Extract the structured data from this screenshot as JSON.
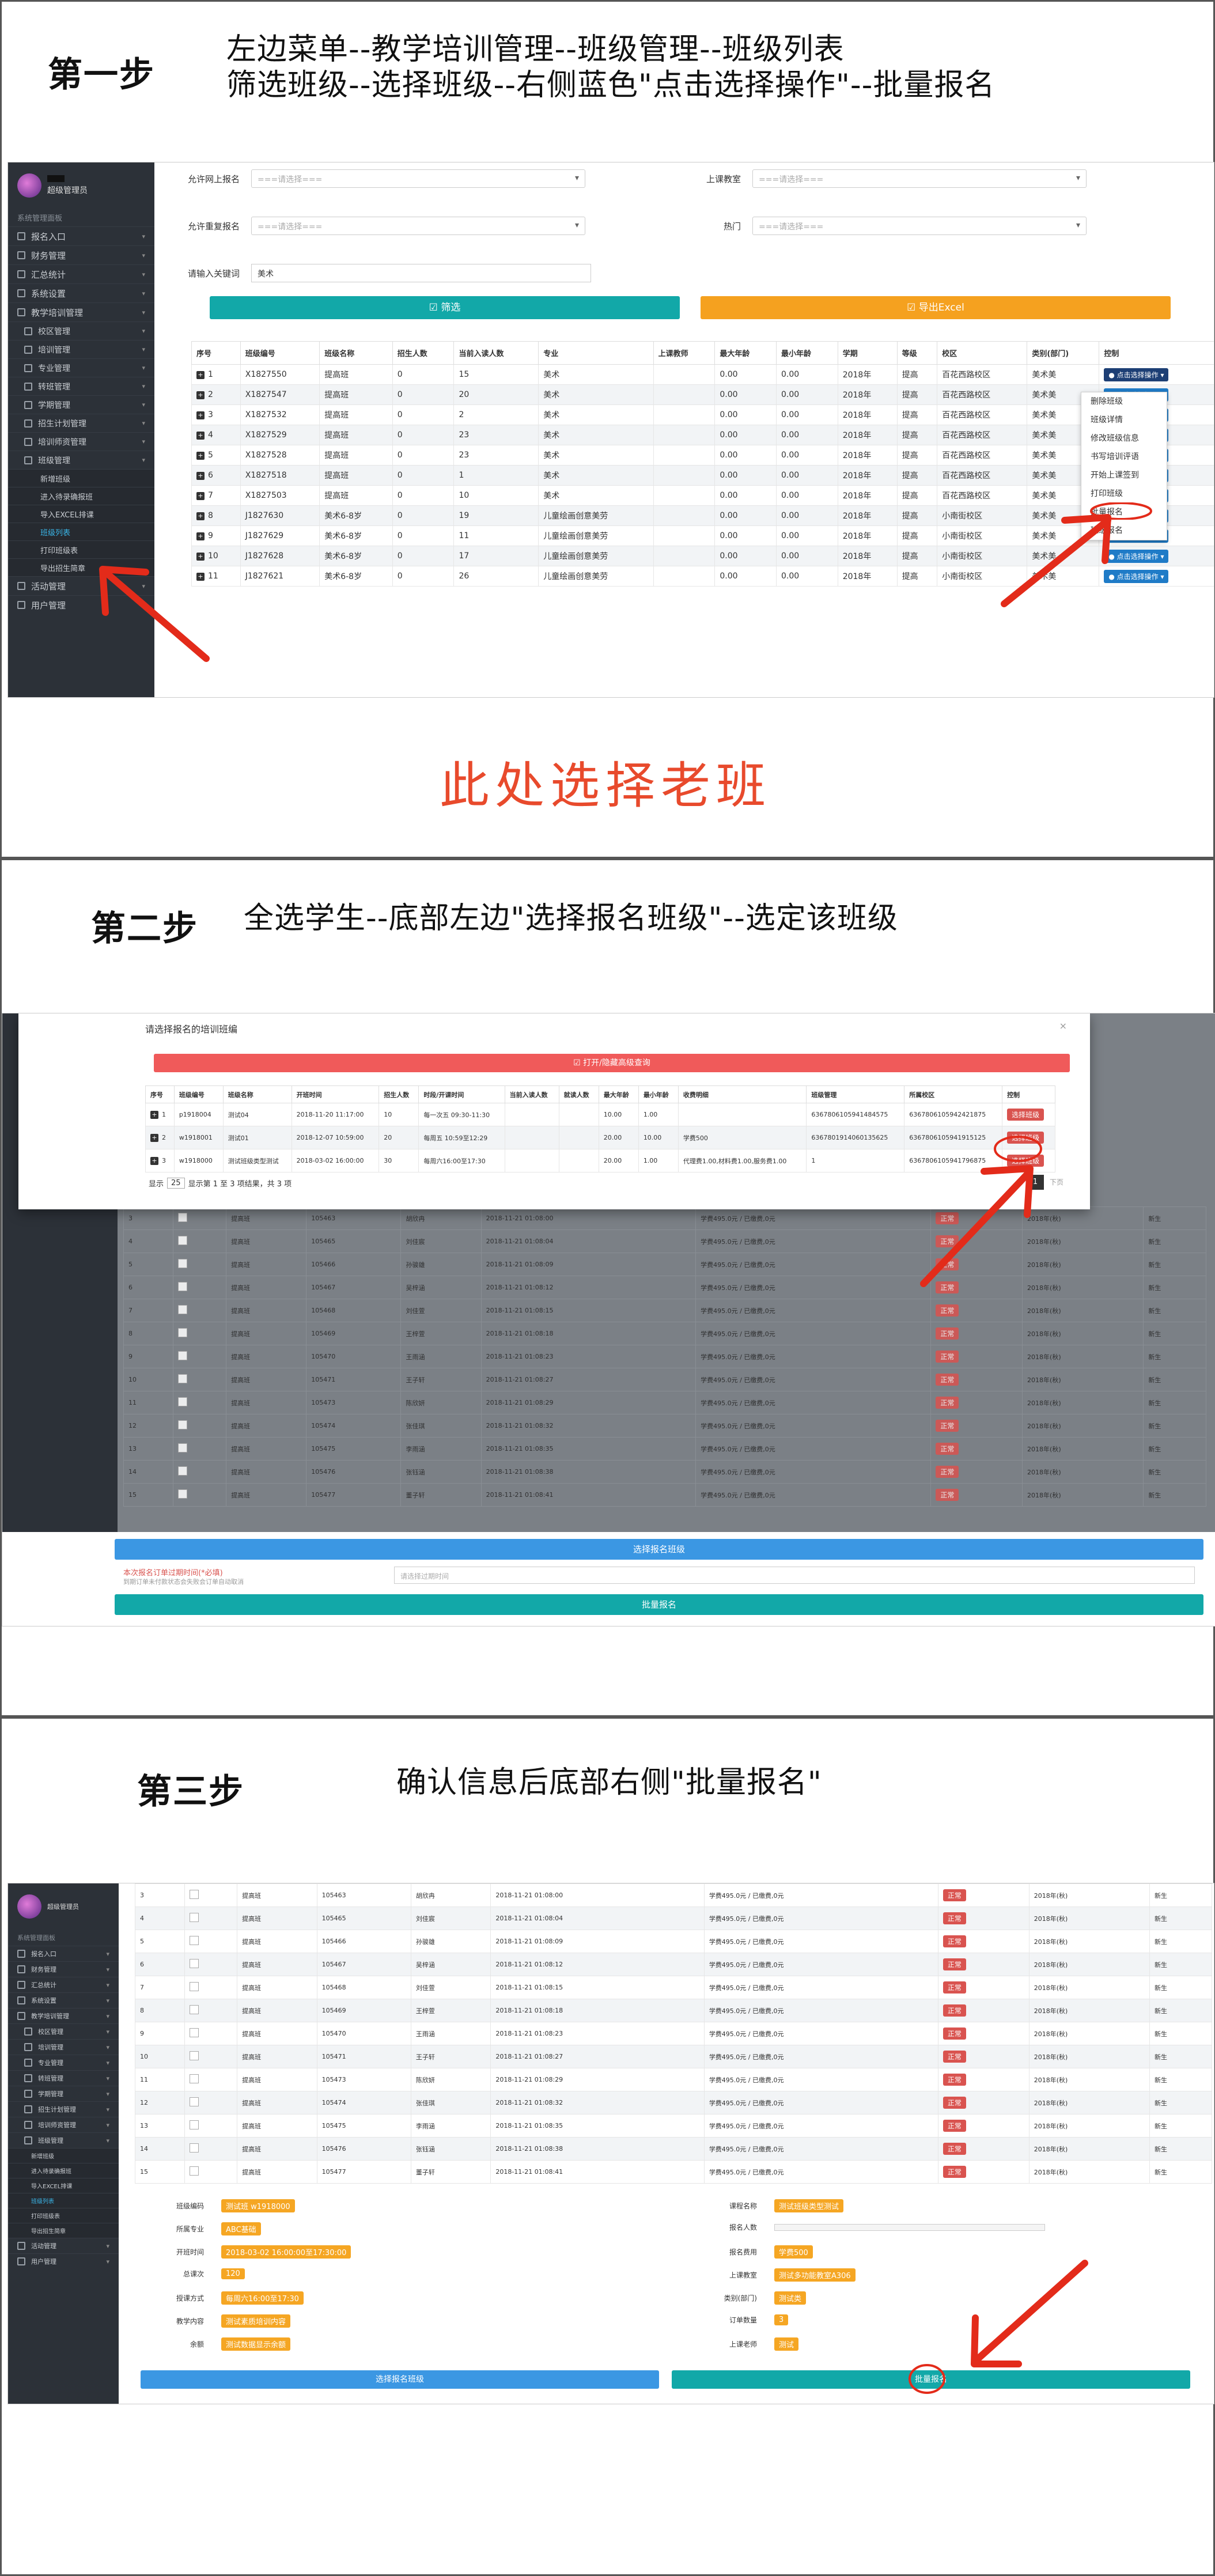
{
  "step1": {
    "label": "第一步",
    "desc1": "左边菜单--教学培训管理--班级管理--班级列表",
    "desc2": "筛选班级--选择班级--右侧蓝色\"点击选择操作\"--批量报名",
    "note": "此处选择老班",
    "sidebar": {
      "user": "超级管理员",
      "section": "系统管理面板",
      "items": [
        "报名入口",
        "财务管理",
        "汇总统计",
        "系统设置",
        "教学培训管理"
      ],
      "subitems": [
        "校区管理",
        "培训管理",
        "专业管理",
        "转班管理",
        "学期管理",
        "招生计划管理",
        "培训师资管理",
        "班级管理"
      ],
      "sub2": [
        "新增班级",
        "进入待录确报班",
        "导入EXCEL排课",
        "班级列表",
        "打印班级表",
        "导出招生简章"
      ],
      "bottom": [
        "活动管理",
        "用户管理"
      ]
    },
    "filters": {
      "f1_label": "允许网上报名",
      "f1_val": "===请选择===",
      "f2_label": "上课教室",
      "f2_val": "===请选择===",
      "f3_label": "允许重复报名",
      "f3_val": "===请选择===",
      "f4_label": "热门",
      "f4_val": "===请选择===",
      "kw_label": "请输入关键词",
      "kw_val": "美术"
    },
    "btn_filter": "☑ 筛选",
    "btn_export": "☑ 导出Excel",
    "columns": [
      "序号",
      "班级编号",
      "班级名称",
      "招生人数",
      "当前入读人数",
      "专业",
      "上课教师",
      "最大年龄",
      "最小年龄",
      "学期",
      "等级",
      "校区",
      "类别(部门)",
      "控制"
    ],
    "rows": [
      [
        "1",
        "X1827550",
        "提高班",
        "0",
        "15",
        "美术",
        "",
        "0.00",
        "0.00",
        "2018年",
        "提高",
        "百花西路校区",
        "美术美"
      ],
      [
        "2",
        "X1827547",
        "提高班",
        "0",
        "20",
        "美术",
        "",
        "0.00",
        "0.00",
        "2018年",
        "提高",
        "百花西路校区",
        "美术美"
      ],
      [
        "3",
        "X1827532",
        "提高班",
        "0",
        "2",
        "美术",
        "",
        "0.00",
        "0.00",
        "2018年",
        "提高",
        "百花西路校区",
        "美术美"
      ],
      [
        "4",
        "X1827529",
        "提高班",
        "0",
        "23",
        "美术",
        "",
        "0.00",
        "0.00",
        "2018年",
        "提高",
        "百花西路校区",
        "美术美"
      ],
      [
        "5",
        "X1827528",
        "提高班",
        "0",
        "23",
        "美术",
        "",
        "0.00",
        "0.00",
        "2018年",
        "提高",
        "百花西路校区",
        "美术美"
      ],
      [
        "6",
        "X1827518",
        "提高班",
        "0",
        "1",
        "美术",
        "",
        "0.00",
        "0.00",
        "2018年",
        "提高",
        "百花西路校区",
        "美术美"
      ],
      [
        "7",
        "X1827503",
        "提高班",
        "0",
        "10",
        "美术",
        "",
        "0.00",
        "0.00",
        "2018年",
        "提高",
        "百花西路校区",
        "美术美"
      ],
      [
        "8",
        "J1827630",
        "美术6-8岁",
        "0",
        "19",
        "儿童绘画创意美劳",
        "",
        "0.00",
        "0.00",
        "2018年",
        "提高",
        "小南街校区",
        "美术美"
      ],
      [
        "9",
        "J1827629",
        "美术6-8岁",
        "0",
        "11",
        "儿童绘画创意美劳",
        "",
        "0.00",
        "0.00",
        "2018年",
        "提高",
        "小南街校区",
        "美术美"
      ],
      [
        "10",
        "J1827628",
        "美术6-8岁",
        "0",
        "17",
        "儿童绘画创意美劳",
        "",
        "0.00",
        "0.00",
        "2018年",
        "提高",
        "小南街校区",
        "美术美"
      ],
      [
        "11",
        "J1827621",
        "美术6-8岁",
        "0",
        "26",
        "儿童绘画创意美劳",
        "",
        "0.00",
        "0.00",
        "2018年",
        "提高",
        "小南街校区",
        "美术美"
      ]
    ],
    "op_label": "● 点击选择操作 ▾",
    "menu": [
      "删除班级",
      "班级详情",
      "修改班级信息",
      "书写培训评语",
      "开始上课签到",
      "打印班级",
      "批量报名",
      "班级报名"
    ]
  },
  "step2": {
    "label": "第二步",
    "desc": "全选学生--底部左边\"选择报名班级\"--选定该班级",
    "modal_title": "请选择报名的培训班编",
    "modal_btn": "☑ 打开/隐藏高级查询",
    "columns": [
      "序号",
      "班级编号",
      "班级名称",
      "开班时间",
      "招生人数",
      "时段/开课时间",
      "当前入读人数",
      "就读人数",
      "最大年龄",
      "最小年龄",
      "收费明细",
      "班级管理",
      "所属校区",
      "控制"
    ],
    "rows": [
      [
        "1",
        "p1918004",
        "测试04",
        "2018-11-20 11:17:00",
        "10",
        "每一次五 09:30-11:30",
        "",
        "",
        "10.00",
        "1.00",
        "",
        "6367806105941484575",
        "6367806105942421875"
      ],
      [
        "2",
        "w1918001",
        "测试01",
        "2018-12-07 10:59:00",
        "20",
        "每周五 10:59至12:29",
        "",
        "",
        "20.00",
        "10.00",
        "学费500",
        "6367801914060135625",
        "6367806105941915125"
      ],
      [
        "3",
        "w1918000",
        "测试班级类型测试",
        "2018-03-02 16:00:00",
        "30",
        "每周六16:00至17:30",
        "",
        "",
        "20.00",
        "1.00",
        "代理费1.00,材料费1.00,服务费1.00",
        "1",
        "6367806105941796875"
      ]
    ],
    "choose": "选择班级",
    "pager_show": "显示",
    "pager_num": "25",
    "pager_info": "显示第 1 至 3 项结果，共 3 项",
    "page_cur": "1",
    "page_next": "下页",
    "bottom_btn": "选择报名班级",
    "expire_label": "本次报名订单过期时间(*必填)",
    "expire_hint": "到期订单未付款状态会失败会订单自动取消",
    "expire_ph": "请选择过期时间",
    "batch_btn": "批量报名"
  },
  "step3": {
    "label": "第三步",
    "desc": "确认信息后底部右侧\"批量报名\"",
    "rows": [
      [
        "3",
        "提高班",
        "105463",
        "胡欣冉",
        "2018-11-21 01:08:00",
        "学费495.0元 / 已缴费,0元"
      ],
      [
        "4",
        "提高班",
        "105465",
        "刘佳宸",
        "2018-11-21 01:08:04",
        "学费495.0元 / 已缴费,0元"
      ],
      [
        "5",
        "提高班",
        "105466",
        "孙骏雄",
        "2018-11-21 01:08:09",
        "学费495.0元 / 已缴费,0元"
      ],
      [
        "6",
        "提高班",
        "105467",
        "吴梓涵",
        "2018-11-21 01:08:12",
        "学费495.0元 / 已缴费,0元"
      ],
      [
        "7",
        "提高班",
        "105468",
        "刘佳萱",
        "2018-11-21 01:08:15",
        "学费495.0元 / 已缴费,0元"
      ],
      [
        "8",
        "提高班",
        "105469",
        "王梓萱",
        "2018-11-21 01:08:18",
        "学费495.0元 / 已缴费,0元"
      ],
      [
        "9",
        "提高班",
        "105470",
        "王雨涵",
        "2018-11-21 01:08:23",
        "学费495.0元 / 已缴费,0元"
      ],
      [
        "10",
        "提高班",
        "105471",
        "王子轩",
        "2018-11-21 01:08:27",
        "学费495.0元 / 已缴费,0元"
      ],
      [
        "11",
        "提高班",
        "105473",
        "陈欣妍",
        "2018-11-21 01:08:29",
        "学费495.0元 / 已缴费,0元"
      ],
      [
        "12",
        "提高班",
        "105474",
        "张佳琪",
        "2018-11-21 01:08:32",
        "学费495.0元 / 已缴费,0元"
      ],
      [
        "13",
        "提高班",
        "105475",
        "李雨涵",
        "2018-11-21 01:08:35",
        "学费495.0元 / 已缴费,0元"
      ],
      [
        "14",
        "提高班",
        "105476",
        "张钰涵",
        "2018-11-21 01:08:38",
        "学费495.0元 / 已缴费,0元"
      ],
      [
        "15",
        "提高班",
        "105477",
        "董子轩",
        "2018-11-21 01:08:41",
        "学费495.0元 / 已缴费,0元"
      ]
    ],
    "status": "正常",
    "term": "2018年(秋)",
    "type": "新生",
    "info_left": [
      [
        "班级编码",
        "测试班 w1918000"
      ],
      [
        "所属专业",
        "ABC基础"
      ],
      [
        "开班时间",
        "2018-03-02 16:00:00至17:30:00"
      ],
      [
        "总课次",
        "120"
      ],
      [
        "授课方式",
        "每周六16:00至17:30"
      ],
      [
        "教学内容",
        "测试素质培训内容"
      ],
      [
        "余额",
        "测试数据显示余额"
      ]
    ],
    "info_right": [
      [
        "课程名称",
        "测试班级类型测试"
      ],
      [
        "报名人数",
        ""
      ],
      [
        "报名费用",
        "学费500"
      ],
      [
        "上课教室",
        "测试多功能教室A306"
      ],
      [
        "类别(部门)",
        "测试类"
      ],
      [
        "订单数量",
        "3"
      ],
      [
        "上课老师",
        "测试"
      ]
    ],
    "btn_left": "选择报名班级",
    "btn_right": "批量报名"
  },
  "colors": {
    "teal": "#12a8a8",
    "orange": "#f5a11f",
    "blue": "#3b97e3",
    "red": "#e32b1a",
    "sidebar": "#2c3138"
  }
}
